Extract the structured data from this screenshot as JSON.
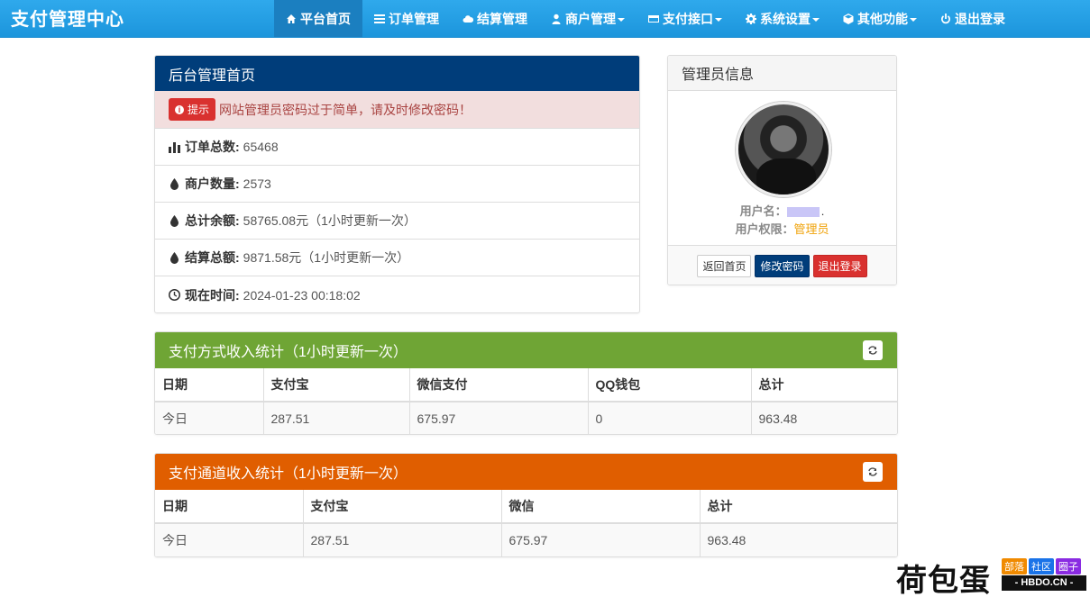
{
  "app": {
    "brand": "支付管理中心"
  },
  "nav": {
    "items": [
      {
        "label": "平台首页",
        "icon": "home-icon",
        "active": true
      },
      {
        "label": "订单管理",
        "icon": "list-icon"
      },
      {
        "label": "结算管理",
        "icon": "cloud-icon"
      },
      {
        "label": "商户管理",
        "icon": "user-icon",
        "dropdown": true
      },
      {
        "label": "支付接口",
        "icon": "credit-card-icon",
        "dropdown": true
      },
      {
        "label": "系统设置",
        "icon": "gear-icon",
        "dropdown": true
      },
      {
        "label": "其他功能",
        "icon": "cube-icon",
        "dropdown": true
      },
      {
        "label": "退出登录",
        "icon": "power-icon"
      }
    ]
  },
  "main_panel": {
    "title": "后台管理首页",
    "alert": {
      "tag": "提示",
      "text": "网站管理员密码过于简单，请及时修改密码！"
    },
    "stats": [
      {
        "label": "订单总数:",
        "value": "65468",
        "icon": "bar-chart-icon"
      },
      {
        "label": "商户数量:",
        "value": "2573",
        "icon": "droplet-icon"
      },
      {
        "label": "总计余额:",
        "value": "58765.08元（1小时更新一次）",
        "icon": "droplet-icon"
      },
      {
        "label": "结算总额:",
        "value": "9871.58元（1小时更新一次）",
        "icon": "droplet-icon"
      },
      {
        "label": "现在时间:",
        "value": "2024-01-23 00:18:02",
        "icon": "clock-icon"
      }
    ]
  },
  "admin_panel": {
    "title": "管理员信息",
    "username_label": "用户名：",
    "username_suffix": ".",
    "role_label": "用户权限：",
    "role": "管理员",
    "buttons": {
      "home": "返回首页",
      "change_password": "修改密码",
      "logout": "退出登录"
    }
  },
  "pay_method_panel": {
    "title": "支付方式收入统计（1小时更新一次）",
    "headers": [
      "日期",
      "支付宝",
      "微信支付",
      "QQ钱包",
      "总计"
    ],
    "rows": [
      [
        "今日",
        "287.51",
        "675.97",
        "0",
        "963.48"
      ]
    ]
  },
  "pay_channel_panel": {
    "title": "支付通道收入统计（1小时更新一次）",
    "headers": [
      "日期",
      "支付宝",
      "微信",
      "总计"
    ],
    "rows": [
      [
        "今日",
        "287.51",
        "675.97",
        "963.48"
      ]
    ]
  },
  "watermark": {
    "title": "荷包蛋",
    "tags": [
      {
        "label": "部落",
        "color": "#f08a00"
      },
      {
        "label": "社区",
        "color": "#1a73e8"
      },
      {
        "label": "圈子",
        "color": "#8a2be2"
      }
    ],
    "url": "- HBDO.CN -"
  },
  "colors": {
    "navbar": "#1c95dc",
    "main_heading": "#003d7a",
    "pay_method_heading": "#6fa535",
    "pay_channel_heading": "#e05e00",
    "role": "#f0a30a",
    "danger": "#d9312f"
  }
}
